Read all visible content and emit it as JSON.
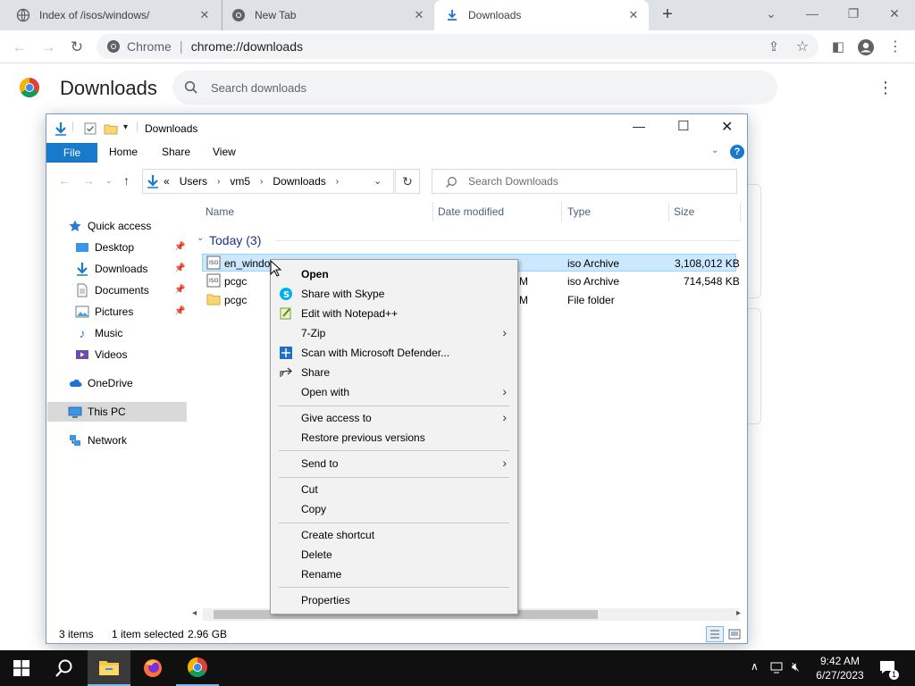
{
  "browser": {
    "tabs": [
      {
        "label": "Index of /isos/windows/"
      },
      {
        "label": "New Tab"
      },
      {
        "label": "Downloads"
      }
    ],
    "omnibox": {
      "site": "Chrome",
      "url": "chrome://downloads"
    }
  },
  "downloads_page": {
    "title": "Downloads",
    "search_placeholder": "Search downloads"
  },
  "explorer": {
    "title": "Downloads",
    "ribbon_tabs": [
      "File",
      "Home",
      "Share",
      "View"
    ],
    "address": {
      "prefix": "«",
      "crumbs": [
        "Users",
        "vm5",
        "Downloads"
      ]
    },
    "search_placeholder": "Search Downloads",
    "nav": {
      "quick_access": "Quick access",
      "desktop": "Desktop",
      "downloads": "Downloads",
      "documents": "Documents",
      "pictures": "Pictures",
      "music": "Music",
      "videos": "Videos",
      "onedrive": "OneDrive",
      "this_pc": "This PC",
      "network": "Network"
    },
    "columns": {
      "name": "Name",
      "date": "Date modified",
      "type": "Type",
      "size": "Size"
    },
    "group": "Today (3)",
    "files": [
      {
        "name": "en_windo",
        "date": "",
        "type": "iso Archive",
        "size": "3,108,012 KB"
      },
      {
        "name": "pcgc",
        "date": "M",
        "type": "iso Archive",
        "size": "714,548 KB"
      },
      {
        "name": "pcgc",
        "date": "M",
        "type": "File folder",
        "size": ""
      }
    ],
    "status": {
      "items": "3 items",
      "selected": "1 item selected",
      "size": "2.96 GB"
    }
  },
  "context_menu": {
    "open": "Open",
    "skype": "Share with Skype",
    "notepad": "Edit with Notepad++",
    "zip": "7-Zip",
    "defender": "Scan with Microsoft Defender...",
    "share": "Share",
    "open_with": "Open with",
    "give_access": "Give access to",
    "restore": "Restore previous versions",
    "send_to": "Send to",
    "cut": "Cut",
    "copy": "Copy",
    "create_shortcut": "Create shortcut",
    "delete": "Delete",
    "rename": "Rename",
    "properties": "Properties"
  },
  "taskbar": {
    "time": "9:42 AM",
    "date": "6/27/2023",
    "notification_count": "1"
  },
  "colors": {
    "accent": "#1979ca",
    "selection": "#cce8ff",
    "taskbar": "#101010"
  }
}
